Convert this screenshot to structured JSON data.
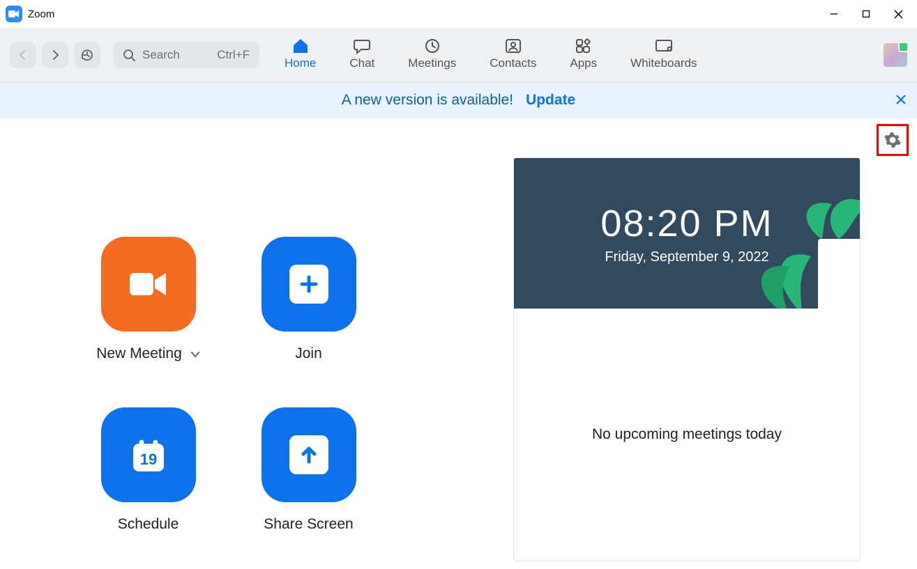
{
  "window": {
    "title": "Zoom"
  },
  "toolbar": {
    "search_placeholder": "Search",
    "search_shortcut": "Ctrl+F"
  },
  "tabs": {
    "home": "Home",
    "chat": "Chat",
    "meetings": "Meetings",
    "contacts": "Contacts",
    "apps": "Apps",
    "whiteboards": "Whiteboards"
  },
  "banner": {
    "text": "A new version is available!",
    "action": "Update"
  },
  "actions": {
    "new_meeting": "New Meeting",
    "join": "Join",
    "schedule": "Schedule",
    "share_screen": "Share Screen",
    "schedule_day": "19"
  },
  "clock": {
    "time": "08:20 PM",
    "date": "Friday, September 9, 2022"
  },
  "upcoming": {
    "empty_text": "No upcoming meetings today"
  }
}
